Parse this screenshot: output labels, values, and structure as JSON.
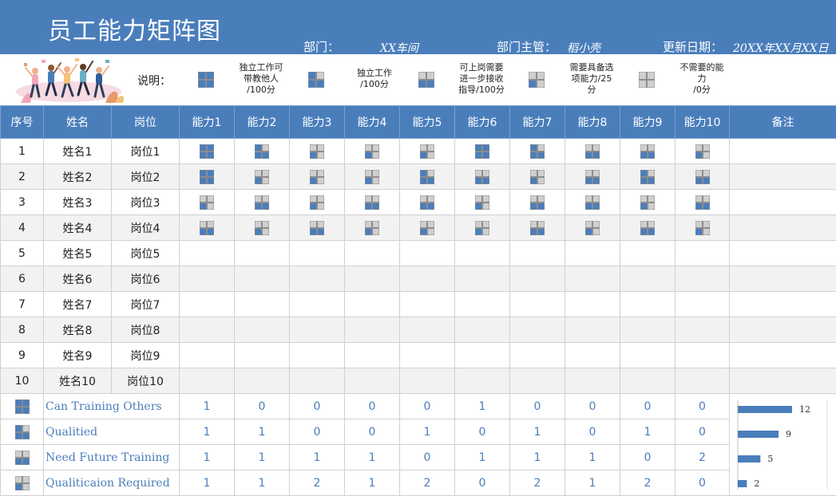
{
  "header": {
    "title": "员工能力矩阵图",
    "department_label": "部门：",
    "department_value": "XX车间",
    "manager_label": "部门主管：",
    "manager_value": "稻小壳",
    "date_label": "更新日期：",
    "date_value": "20XX年XX月XX日"
  },
  "legend": {
    "label": "说明：",
    "items": [
      {
        "icon": "square-icon-full",
        "filled": 4,
        "text": [
          "独立工作可",
          "带教他人",
          "/100分"
        ]
      },
      {
        "icon": "square-icon-three-quarter",
        "filled": 3,
        "text": [
          "独立工作",
          "/100分"
        ]
      },
      {
        "icon": "square-icon-half",
        "filled": 2,
        "text": [
          "可上岗需要",
          "进一步接收",
          "指导/100分"
        ]
      },
      {
        "icon": "square-icon-quarter",
        "filled": 1,
        "text": [
          "需要具备选",
          "项能力/25",
          "分"
        ]
      },
      {
        "icon": "square-icon-empty",
        "filled": 0,
        "text": [
          "不需要的能",
          "力",
          "/0分"
        ]
      }
    ]
  },
  "colors": {
    "accent": "#4a7ebb",
    "empty_quad": "#cfcfcf",
    "alt_row": "#f2f2f2"
  },
  "table": {
    "headers": [
      "序号",
      "姓名",
      "岗位",
      "能力1",
      "能力2",
      "能力3",
      "能力4",
      "能力5",
      "能力6",
      "能力7",
      "能力8",
      "能力9",
      "能力10",
      "备注"
    ],
    "rows": [
      {
        "no": "1",
        "name": "姓名1",
        "post": "岗位1",
        "levels": [
          4,
          3,
          1,
          1,
          1,
          4,
          3,
          2,
          2,
          1
        ]
      },
      {
        "no": "2",
        "name": "姓名2",
        "post": "岗位2",
        "levels": [
          4,
          1,
          1,
          1,
          3,
          2,
          1,
          2,
          3,
          2
        ]
      },
      {
        "no": "3",
        "name": "姓名3",
        "post": "岗位3",
        "levels": [
          1,
          2,
          1,
          2,
          2,
          1,
          2,
          2,
          1,
          2
        ]
      },
      {
        "no": "4",
        "name": "姓名4",
        "post": "岗位4",
        "levels": [
          2,
          1,
          2,
          1,
          1,
          1,
          2,
          1,
          2,
          1
        ]
      },
      {
        "no": "5",
        "name": "姓名5",
        "post": "岗位5",
        "levels": []
      },
      {
        "no": "6",
        "name": "姓名6",
        "post": "岗位6",
        "levels": []
      },
      {
        "no": "7",
        "name": "姓名7",
        "post": "岗位7",
        "levels": []
      },
      {
        "no": "8",
        "name": "姓名8",
        "post": "岗位8",
        "levels": []
      },
      {
        "no": "9",
        "name": "姓名9",
        "post": "岗位9",
        "levels": []
      },
      {
        "no": "10",
        "name": "姓名10",
        "post": "岗位10",
        "levels": []
      }
    ],
    "summary": [
      {
        "label": "Can Training Others",
        "icon_filled": 4,
        "values": [
          1,
          0,
          0,
          0,
          0,
          1,
          0,
          0,
          0,
          0
        ]
      },
      {
        "label": "Qualitied",
        "icon_filled": 3,
        "values": [
          1,
          1,
          0,
          0,
          1,
          0,
          1,
          0,
          1,
          0
        ]
      },
      {
        "label": "Need Future Training",
        "icon_filled": 2,
        "values": [
          1,
          1,
          1,
          1,
          0,
          1,
          1,
          1,
          0,
          2
        ]
      },
      {
        "label": "Qualiticaion Required",
        "icon_filled": 1,
        "values": [
          1,
          1,
          2,
          1,
          2,
          0,
          2,
          1,
          2,
          0
        ]
      }
    ]
  },
  "chart_data": {
    "type": "bar",
    "orientation": "horizontal",
    "categories": [
      "Can Training Others",
      "Qualitied",
      "Need Future Training",
      "Qualiticaion Required"
    ],
    "values": [
      12,
      9,
      5,
      2
    ],
    "title": "",
    "xlabel": "",
    "ylabel": "",
    "color": "#4a7ebb"
  }
}
